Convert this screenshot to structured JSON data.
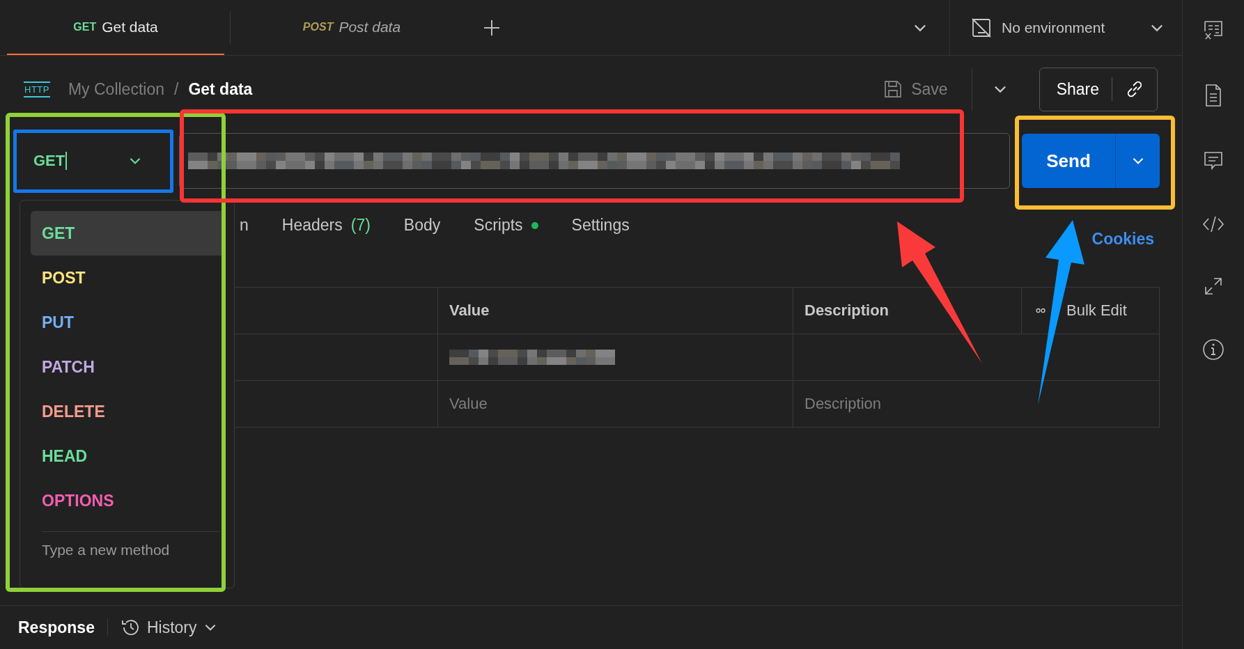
{
  "tabs": [
    {
      "method": "GET",
      "title": "Get data",
      "color": "#6bdd9a",
      "selected": true,
      "preview": false
    },
    {
      "method": "POST",
      "title": "Post data",
      "color": "#b09d57",
      "selected": false,
      "preview": true
    }
  ],
  "environment": {
    "label": "No environment"
  },
  "breadcrumb": {
    "badge": "HTTP",
    "collection": "My Collection",
    "separator": "/",
    "request": "Get data"
  },
  "toolbar": {
    "save": "Save",
    "share": "Share"
  },
  "request": {
    "method": "GET",
    "send": "Send"
  },
  "method_menu": {
    "items": [
      {
        "label": "GET",
        "color": "#6bdd9a",
        "selected": true
      },
      {
        "label": "POST",
        "color": "#ffe47e",
        "selected": false
      },
      {
        "label": "PUT",
        "color": "#74aef6",
        "selected": false
      },
      {
        "label": "PATCH",
        "color": "#c0a8e1",
        "selected": false
      },
      {
        "label": "DELETE",
        "color": "#f79a8e",
        "selected": false
      },
      {
        "label": "HEAD",
        "color": "#6bdd9a",
        "selected": false
      },
      {
        "label": "OPTIONS",
        "color": "#f15eb0",
        "selected": false
      }
    ],
    "placeholder": "Type a new method"
  },
  "request_tabs": [
    {
      "label": "n",
      "dot": false
    },
    {
      "label": "Headers",
      "count": "(7)",
      "dot": false
    },
    {
      "label": "Body",
      "dot": false
    },
    {
      "label": "Scripts",
      "dot": true
    },
    {
      "label": "Settings",
      "dot": false
    }
  ],
  "cookies": "Cookies",
  "table": {
    "columns": [
      {
        "label": "Value"
      },
      {
        "label": "Description"
      }
    ],
    "bulk_edit": "Bulk Edit",
    "rows": [
      {
        "kind": "filled"
      },
      {
        "kind": "empty",
        "value_placeholder": "Value",
        "description_placeholder": "Description"
      }
    ]
  },
  "response_bar": {
    "response": "Response",
    "history": "History"
  }
}
